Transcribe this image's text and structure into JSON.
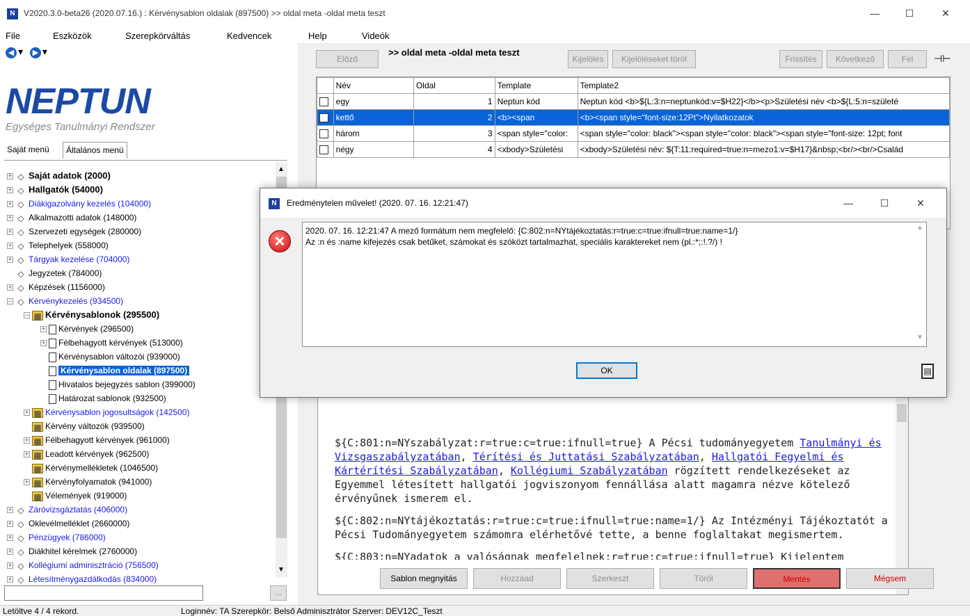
{
  "window": {
    "title": "V2020.3.0-beta26 (2020.07.16.) : Kérvénysablon oldalak (897500) >> oldal meta -oldal meta teszt",
    "minimize": "—",
    "maximize": "☐",
    "close": "✕",
    "app_icon": "N"
  },
  "menu": [
    "File",
    "Eszközök",
    "Szerepkörváltás",
    "Kedvencek",
    "Help",
    "Videók"
  ],
  "logo": {
    "main": "NEPTUN",
    "sub": "Egységes Tanulmányi Rendszer"
  },
  "left_tabs": [
    "Saját menü",
    "Általános menü"
  ],
  "tree": [
    {
      "label": "Saját adatok (2000)",
      "style": "bold"
    },
    {
      "label": "Hallgatók (54000)",
      "style": "bold"
    },
    {
      "label": "Diákigazolvány kezelés (104000)",
      "style": "blue"
    },
    {
      "label": "Alkalmazotti adatok (148000)",
      "style": "normal"
    },
    {
      "label": "Szervezeti egységek (280000)",
      "style": "normal"
    },
    {
      "label": "Telephelyek (558000)",
      "style": "normal"
    },
    {
      "label": "Tárgyak kezelése (704000)",
      "style": "blue"
    },
    {
      "label": "Jegyzetek (784000)",
      "style": "normal"
    },
    {
      "label": "Képzések (1156000)",
      "style": "normal"
    },
    {
      "label": "Kérvénykezelés (934500)",
      "style": "blue"
    },
    {
      "label": "Kérvénysablonok (295500)",
      "style": "bold"
    },
    {
      "label": "Kérvények (296500)",
      "style": "normal"
    },
    {
      "label": "Félbehagyott kérvények (513000)",
      "style": "normal"
    },
    {
      "label": "Kérvénysablon változói (939000)",
      "style": "normal"
    },
    {
      "label": "Kérvénysablon oldalak (897500)",
      "style": "selected"
    },
    {
      "label": "Hivatalos bejegyzés sablon (399000)",
      "style": "normal"
    },
    {
      "label": "Határozat sablonok (932500)",
      "style": "normal"
    },
    {
      "label": "Kérvénysablon jogosultságok (142500)",
      "style": "blue"
    },
    {
      "label": "Kérvény változók (939500)",
      "style": "normal"
    },
    {
      "label": "Félbehagyott kérvények (961000)",
      "style": "normal"
    },
    {
      "label": "Leadott kérvények (962500)",
      "style": "normal"
    },
    {
      "label": "Kérvénymellékletek (1046500)",
      "style": "normal"
    },
    {
      "label": "Kérvényfolyamatok (941000)",
      "style": "normal"
    },
    {
      "label": "Vélemények (919000)",
      "style": "normal"
    },
    {
      "label": "Záróvizsgáztatás (406000)",
      "style": "blue"
    },
    {
      "label": "Oklevélmelléklet (2660000)",
      "style": "normal"
    },
    {
      "label": "Pénzügyek (786000)",
      "style": "blue"
    },
    {
      "label": "Diákhitel kérelmek (2760000)",
      "style": "normal"
    },
    {
      "label": "Kollégiumi adminisztráció (756500)",
      "style": "blue"
    },
    {
      "label": "Létesítménygazdálkodás (834000)",
      "style": "blue"
    }
  ],
  "toolbar": {
    "prev": "Előző",
    "page_title": ">> oldal meta -oldal meta teszt",
    "select": "Kijelölés",
    "clear_select": "Kijelöléseket töröl",
    "refresh": "Frissítés",
    "next": "Következő",
    "up": "Fel",
    "pin": "⊣⊢"
  },
  "grid": {
    "columns": [
      "Név",
      "Oldal",
      "Template",
      "Template2"
    ],
    "rows": [
      {
        "name": "egy",
        "page": "1",
        "template": "Neptun kód",
        "template2": "Neptun kód <b>${L:3:n=neptunkód:v=$H22}</b><p>Születési név <b>${L:5:n=születé"
      },
      {
        "name": "kettő",
        "page": "2",
        "template": "<b><span",
        "template2": "<b><span style=\"font-size:12Pt\">Nyilatkozatok"
      },
      {
        "name": "három",
        "page": "3",
        "template": "<span style=\"color:",
        "template2": "<span style=\"color: black\"><span style=\"color: black\"><span style=\"font-size: 12pt; font"
      },
      {
        "name": "négy",
        "page": "4",
        "template": "<xbody>Születési",
        "template2": "<xbody>Születési név: ${T:11:required=true:n=mezo1:v=$H17}&nbsp;<br/><br/>Család"
      }
    ]
  },
  "editor": {
    "p1_a": "${C:801:n=NYszabályzat:r=true:c=true:ifnull=true} A Pécsi tudományegyetem ",
    "link1": "Tanulmányi és Vizsgaszabályzatában",
    "sep1": ", ",
    "link2": "Térítési és Juttatási Szabályzatában",
    "sep2": ", ",
    "link3": "Hallgatói Fegyelmi és Kártérítési Szabályzatában",
    "sep3": ", ",
    "link4": "Kollégiumi Szabályzatában",
    "p1_b": " rögzített rendelkezéseket az Egyemmel létesített hallgatói jogviszonyom fennállása alatt magamra nézve kötelező érvényűnek ismerem el.",
    "p2": "${C:802:n=NYtájékoztatás:r=true:c=true:ifnull=true:name=1/} Az Intézményi Tájékoztatót a Pécsi Tudományegyetem számomra elérhetővé tette, a benne foglaltakat megismertem.",
    "p3": "${C:803:n=NYadatok a valóságnak megfelelnek:r=true:c=true:ifnull=true} Kijelentem"
  },
  "bottom_buttons": {
    "open": "Sablon megnyitás",
    "add": "Hozzáad",
    "edit": "Szerkeszt",
    "delete": "Töröl",
    "save": "Mentés",
    "cancel": "Mégsem"
  },
  "status": {
    "loaded": "Letöltve 4 / 4 rekord.",
    "user": "Loginnév: TA  Szerepkör: Belső Adminisztrátor  Szerver: DEV12C_Teszt"
  },
  "dialog": {
    "title": "Eredménytelen művelet! (2020. 07. 16. 12:21:47)",
    "line1": "2020. 07. 16. 12:21:47  A mező formátum nem megfelelő: {C:802:n=NYtájékoztatás:r=true:c=true:ifnull=true:name=1/}",
    "line2": "Az :n és :name kifejezés csak betűket, számokat és szóközt tartalmazhat, speciális karaktereket nem (pl.:*;:!.?/) !",
    "ok": "OK",
    "error_icon": "error-icon",
    "clipboard_icon": "clipboard-icon"
  }
}
